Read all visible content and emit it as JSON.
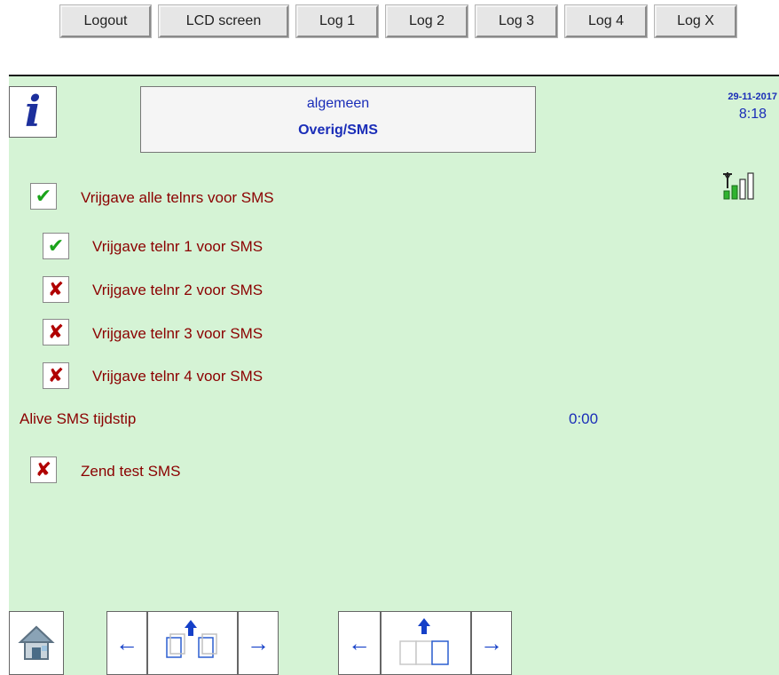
{
  "toolbar": {
    "buttons": [
      "Logout",
      "LCD screen",
      "Log 1",
      "Log 2",
      "Log 3",
      "Log 4",
      "Log X"
    ]
  },
  "header": {
    "info_icon": "i",
    "title_line1": "algemeen",
    "title_line2": "Overig/SMS",
    "date": "29-11-2017",
    "time": "8:18",
    "signal_icon": "signal-strength-icon"
  },
  "settings": {
    "all_numbers": {
      "label": "Vrijgave alle telnrs voor SMS",
      "checked": true
    },
    "numbers": [
      {
        "label": "Vrijgave telnr 1 voor SMS",
        "checked": true
      },
      {
        "label": "Vrijgave telnr 2 voor SMS",
        "checked": false
      },
      {
        "label": "Vrijgave telnr 3 voor SMS",
        "checked": false
      },
      {
        "label": "Vrijgave telnr 4 voor SMS",
        "checked": false
      }
    ],
    "alive": {
      "label": "Alive SMS tijdstip",
      "value": "0:00"
    },
    "test": {
      "label": "Zend test SMS",
      "checked": false
    }
  },
  "marks": {
    "check": "✔",
    "cross": "✘"
  },
  "nav": {
    "home_icon": "home-icon",
    "left_arrow": "←",
    "right_arrow": "→"
  },
  "colors": {
    "panel_bg": "#d5f3d5",
    "label_text": "#8b0000",
    "value_text": "#1a2db8",
    "check_green": "#1aa31a",
    "cross_red": "#b00000"
  }
}
